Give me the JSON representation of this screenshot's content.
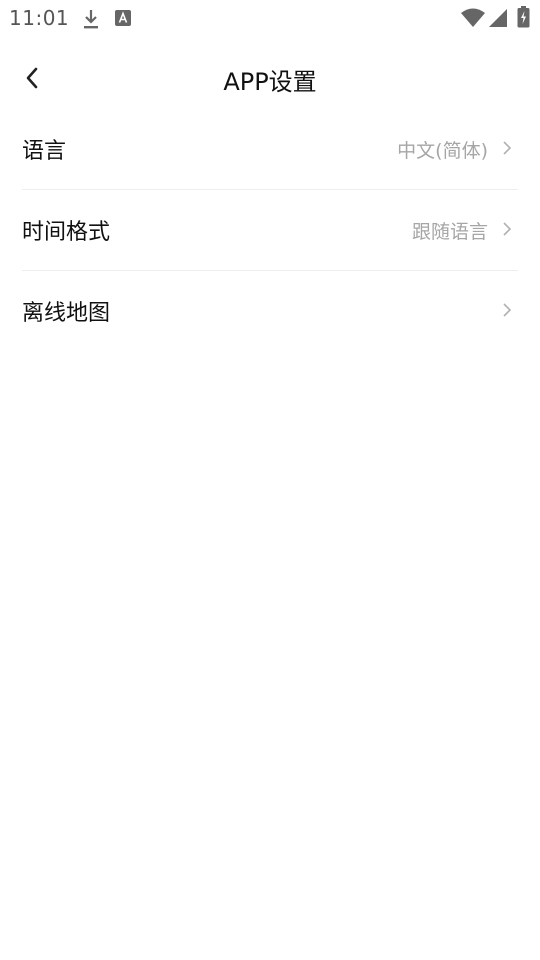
{
  "status_bar": {
    "time": "11:01",
    "icons": [
      "download-icon",
      "a-notification-icon",
      "wifi-icon",
      "signal-icon",
      "battery-icon"
    ]
  },
  "header": {
    "back_icon": "chevron-left-icon",
    "title": "APP设置"
  },
  "settings": {
    "items": [
      {
        "label": "语言",
        "value": "中文(简体)"
      },
      {
        "label": "时间格式",
        "value": "跟随语言"
      },
      {
        "label": "离线地图",
        "value": ""
      }
    ]
  },
  "colors": {
    "background": "#ffffff",
    "text_primary": "#111111",
    "text_secondary": "#a6a6a6",
    "divider": "#eeeeee"
  }
}
